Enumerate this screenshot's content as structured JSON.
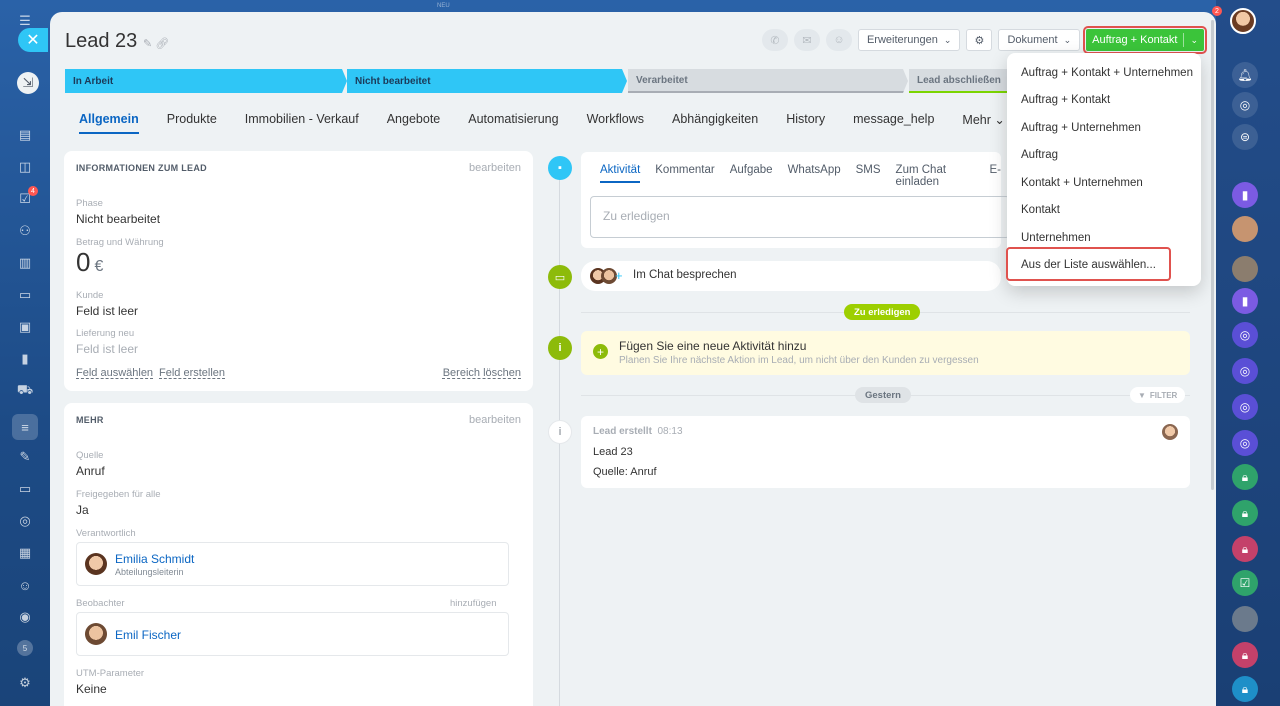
{
  "window": {
    "title": "Lead 23",
    "top_hint": "NEU"
  },
  "left_rail": {
    "badge_tasks": "4",
    "badge_bottom": "5"
  },
  "right_rail": {
    "notification_count": "2"
  },
  "header": {
    "extensions_label": "Erweiterungen",
    "document_label": "Dokument",
    "primary_label": "Auftrag + Kontakt"
  },
  "stages": [
    {
      "label": "In Arbeit",
      "state": "done"
    },
    {
      "label": "Nicht bearbeitet",
      "state": "current"
    },
    {
      "label": "Verarbeitet",
      "state": "pending"
    },
    {
      "label": "Lead abschließen",
      "state": "pending-final"
    }
  ],
  "tabs": [
    "Allgemein",
    "Produkte",
    "Immobilien - Verkauf",
    "Angebote",
    "Automatisierung",
    "Workflows",
    "Abhängigkeiten",
    "History",
    "message_help",
    "Mehr"
  ],
  "info_panel": {
    "title": "INFORMATIONEN ZUM LEAD",
    "edit": "bearbeiten",
    "phase_label": "Phase",
    "phase_value": "Nicht bearbeitet",
    "amount_label": "Betrag und Währung",
    "amount_value": "0",
    "currency": "€",
    "customer_label": "Kunde",
    "customer_value": "Feld ist leer",
    "delivery_label": "Lieferung neu",
    "delivery_value": "Feld ist leer",
    "select_field": "Feld auswählen",
    "create_field": "Feld erstellen",
    "delete_section": "Bereich löschen"
  },
  "more_panel": {
    "title": "MEHR",
    "edit": "bearbeiten",
    "source_label": "Quelle",
    "source_value": "Anruf",
    "shared_label": "Freigegeben für alle",
    "shared_value": "Ja",
    "responsible_label": "Verantwortlich",
    "responsible_name": "Emilia Schmidt",
    "responsible_role": "Abteilungsleiterin",
    "observers_label": "Beobachter",
    "observers_add": "hinzufügen",
    "observer_name": "Emil Fischer",
    "utm_label": "UTM-Parameter",
    "utm_value": "Keine"
  },
  "activity": {
    "tabs": [
      "Aktivität",
      "Kommentar",
      "Aufgabe",
      "WhatsApp",
      "SMS",
      "Zum Chat einladen",
      "E-"
    ],
    "input_placeholder": "Zu erledigen",
    "chat_label": "Im Chat besprechen",
    "todo_pill": "Zu erledigen",
    "add_title": "Fügen Sie eine neue Aktivität hinzu",
    "add_sub": "Planen Sie Ihre nächste Aktion im Lead, um nicht über den Kunden zu vergessen",
    "yesterday_pill": "Gestern",
    "filter": "FILTER",
    "history_title": "Lead erstellt",
    "history_time": "08:13",
    "history_line1": "Lead 23",
    "history_line2": "Quelle: Anruf"
  },
  "dropdown": {
    "items": [
      "Auftrag + Kontakt + Unternehmen",
      "Auftrag + Kontakt",
      "Auftrag + Unternehmen",
      "Auftrag",
      "Kontakt + Unternehmen",
      "Kontakt",
      "Unternehmen",
      "Aus der Liste auswählen..."
    ]
  },
  "colors": {
    "accent": "#2fc6f6",
    "link": "#0b66c3",
    "primary_green": "#3bc43a",
    "highlight": "#e0524e"
  }
}
